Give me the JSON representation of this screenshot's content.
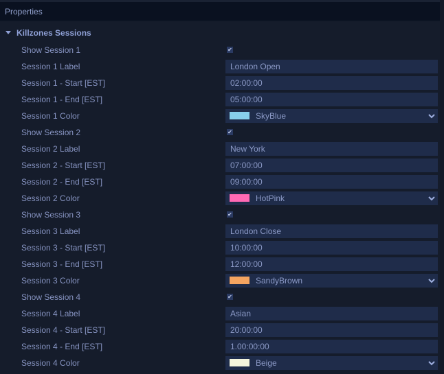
{
  "panel": {
    "title": "Properties"
  },
  "group": {
    "title": "Killzones Sessions",
    "expanded": true
  },
  "rows": [
    {
      "label": "Show Session 1",
      "type": "checkbox",
      "checked": true
    },
    {
      "label": "Session 1 Label",
      "type": "text",
      "value": "London Open"
    },
    {
      "label": "Session 1 - Start [EST]",
      "type": "text",
      "value": "02:00:00"
    },
    {
      "label": "Session 1 - End [EST]",
      "type": "text",
      "value": "05:00:00"
    },
    {
      "label": "Session 1 Color",
      "type": "color",
      "value": "SkyBlue",
      "swatch": "#87ceeb"
    },
    {
      "label": "Show Session 2",
      "type": "checkbox",
      "checked": true
    },
    {
      "label": "Session 2 Label",
      "type": "text",
      "value": "New York"
    },
    {
      "label": "Session 2 - Start [EST]",
      "type": "text",
      "value": "07:00:00"
    },
    {
      "label": "Session 2 - End [EST]",
      "type": "text",
      "value": "09:00:00"
    },
    {
      "label": "Session 2 Color",
      "type": "color",
      "value": "HotPink",
      "swatch": "#ff69b4"
    },
    {
      "label": "Show Session 3",
      "type": "checkbox",
      "checked": true
    },
    {
      "label": "Session 3 Label",
      "type": "text",
      "value": "London Close"
    },
    {
      "label": "Session 3 - Start [EST]",
      "type": "text",
      "value": "10:00:00"
    },
    {
      "label": "Session 3 - End [EST]",
      "type": "text",
      "value": "12:00:00"
    },
    {
      "label": "Session 3 Color",
      "type": "color",
      "value": "SandyBrown",
      "swatch": "#f4a460"
    },
    {
      "label": "Show Session 4",
      "type": "checkbox",
      "checked": true
    },
    {
      "label": "Session 4 Label",
      "type": "text",
      "value": "Asian"
    },
    {
      "label": "Session 4 - Start [EST]",
      "type": "text",
      "value": "20:00:00"
    },
    {
      "label": "Session 4 - End [EST]",
      "type": "text",
      "value": "1.00:00:00"
    },
    {
      "label": "Session 4 Color",
      "type": "color",
      "value": "Beige",
      "swatch": "#f5f5dc"
    }
  ],
  "icons": {
    "check": "✔",
    "expand": "triangle-down-icon",
    "dropdown": "chevron-down-icon"
  }
}
